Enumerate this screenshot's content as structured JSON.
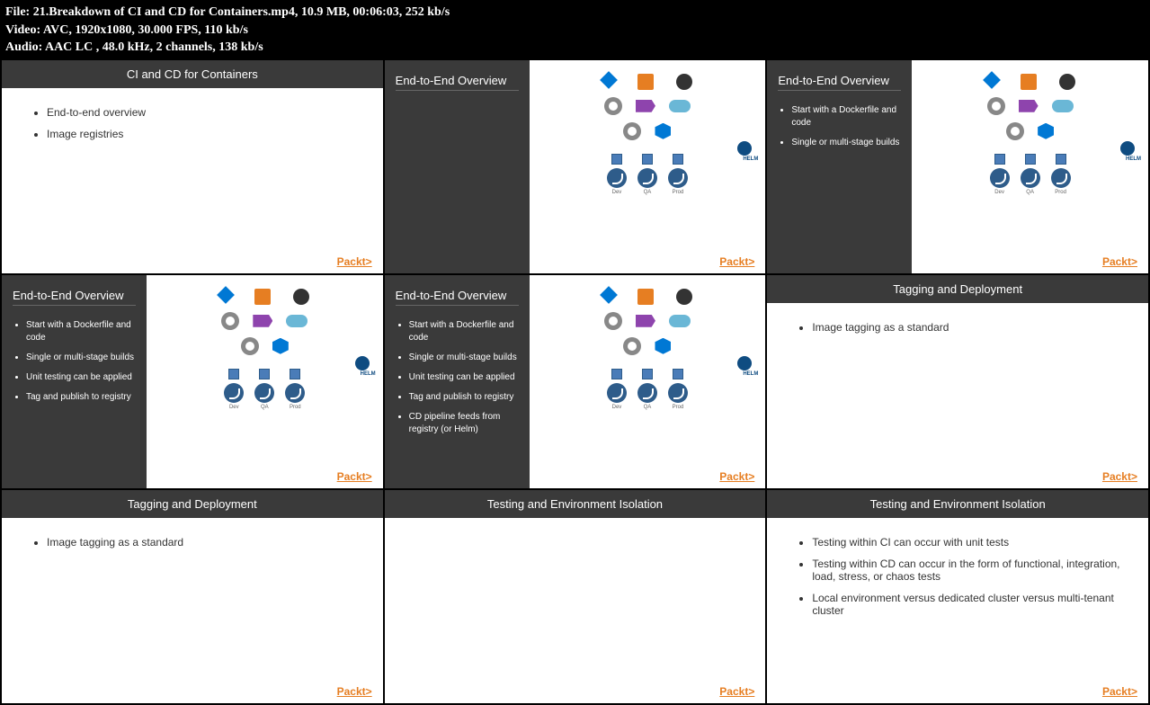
{
  "header": {
    "file": "File: 21.Breakdown of CI and CD for Containers.mp4, 10.9 MB, 00:06:03, 252 kb/s",
    "video": "Video: AVC, 1920x1080, 30.000 FPS, 110 kb/s",
    "audio": "Audio: AAC LC , 48.0 kHz, 2 channels, 138 kb/s"
  },
  "brand": "Packt>",
  "diagram_labels": {
    "dev": "Dev",
    "qa": "QA",
    "prod": "Prod",
    "helm": "HELM"
  },
  "slides": [
    {
      "layout": "full",
      "title": "CI and CD for Containers",
      "bullets": [
        "End-to-end overview",
        "Image registries"
      ]
    },
    {
      "layout": "split",
      "title": "End-to-End Overview",
      "bullets": [],
      "diagram": true
    },
    {
      "layout": "split",
      "title": "End-to-End Overview",
      "bullets": [
        "Start with a Dockerfile and code",
        "Single or multi-stage builds"
      ],
      "diagram": true
    },
    {
      "layout": "split",
      "title": "End-to-End Overview",
      "bullets": [
        "Start with a Dockerfile and code",
        "Single or multi-stage builds",
        "Unit testing can be applied",
        "Tag and publish to registry"
      ],
      "diagram": true
    },
    {
      "layout": "split",
      "title": "End-to-End Overview",
      "bullets": [
        "Start with a Dockerfile and code",
        "Single or multi-stage builds",
        "Unit testing can be applied",
        "Tag and publish to registry",
        "CD pipeline feeds from registry (or Helm)"
      ],
      "diagram": true
    },
    {
      "layout": "full",
      "title": "Tagging and Deployment",
      "bullets": [
        "Image tagging as a standard"
      ]
    },
    {
      "layout": "full",
      "title": "Tagging and Deployment",
      "bullets": [
        "Image tagging as a standard"
      ]
    },
    {
      "layout": "full",
      "title": "Testing and Environment Isolation",
      "bullets": []
    },
    {
      "layout": "full",
      "title": "Testing and Environment Isolation",
      "bullets": [
        "Testing within CI can occur with unit tests",
        "Testing within CD can occur in the form of functional, integration, load, stress, or chaos tests",
        "Local environment versus dedicated cluster versus multi-tenant cluster"
      ]
    }
  ]
}
